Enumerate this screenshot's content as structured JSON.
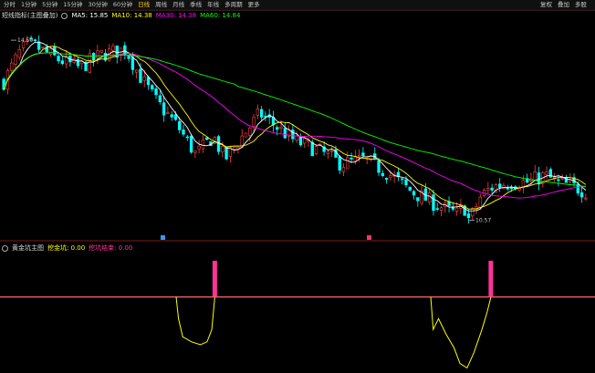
{
  "toolbar": {
    "periods": [
      "分时",
      "1分钟",
      "5分钟",
      "15分钟",
      "30分钟",
      "60分钟",
      "日线",
      "周线",
      "月线",
      "季线",
      "年线"
    ],
    "active_period": 6,
    "extra": [
      "多周期",
      "更多"
    ],
    "right": [
      "复权",
      "叠加",
      "多股"
    ]
  },
  "main_legend": {
    "name": "短线指标(主图叠加)",
    "ma5": {
      "label": "MA5: 15.85",
      "color": "#ffffff"
    },
    "ma10": {
      "label": "MA10: 14.38",
      "color": "#ffff00"
    },
    "ma30": {
      "label": "MA30: 14.38",
      "color": "#ff00ff"
    },
    "ma60": {
      "label": "MA60: 14.84",
      "color": "#00ff00"
    }
  },
  "price_markers": {
    "high": "14.50",
    "low": "10.57"
  },
  "sub_legend": {
    "name": "黄金坑主图",
    "items": [
      {
        "label": "挖金坑: 0.00",
        "color": "#ffff00"
      },
      {
        "label": "挖坑结束: 0.00",
        "color": "#ff3399"
      }
    ]
  },
  "chart_data": [
    {
      "type": "candlestick",
      "title": "",
      "series": [
        {
          "name": "MA5",
          "color": "#ffffff"
        },
        {
          "name": "MA10",
          "color": "#ffff00"
        },
        {
          "name": "MA30",
          "color": "#ff00ff"
        },
        {
          "name": "MA60",
          "color": "#00ff00"
        }
      ],
      "price_range": [
        10.2,
        14.9
      ],
      "annotations": [
        {
          "text": "14.50",
          "type": "high",
          "value": 14.5
        },
        {
          "text": "10.57",
          "type": "low",
          "value": 10.57
        }
      ],
      "up_color": "#ff4040",
      "down_color": "#00ffff",
      "grid": false
    },
    {
      "type": "line",
      "title": "",
      "series": [
        {
          "name": "挖金坑",
          "color": "#ffff00"
        },
        {
          "name": "挖坑结束",
          "color": "#ff3399"
        }
      ],
      "ylim": [
        -1,
        0.6
      ],
      "pits": [
        {
          "x": [
            0.296,
            0.3,
            0.307,
            0.322,
            0.337,
            0.348,
            0.356,
            0.361
          ],
          "y": [
            0,
            -0.3,
            -0.55,
            -0.62,
            -0.66,
            -0.62,
            -0.45,
            0
          ]
        },
        {
          "x": [
            0.724,
            0.728,
            0.737,
            0.75,
            0.763,
            0.773,
            0.785,
            0.796,
            0.81,
            0.819,
            0.825
          ],
          "y": [
            0,
            -0.45,
            -0.3,
            -0.52,
            -0.7,
            -0.92,
            -0.98,
            -0.78,
            -0.45,
            -0.2,
            0
          ]
        }
      ],
      "signals": [
        {
          "x": 0.361,
          "value": 0.5
        },
        {
          "x": 0.825,
          "value": 0.5
        }
      ]
    }
  ]
}
